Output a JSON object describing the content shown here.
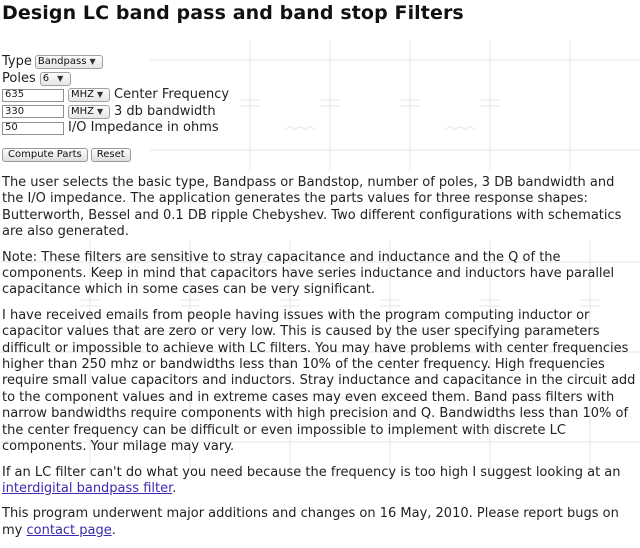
{
  "page": {
    "title": "Design LC band pass and band stop Filters"
  },
  "form": {
    "type_label": "Type",
    "type_value": "Bandpass",
    "poles_label": "Poles",
    "poles_value": "6",
    "center_freq_value": "635",
    "center_freq_unit": "MHZ",
    "center_freq_label": "Center Frequency",
    "bandwidth_value": "330",
    "bandwidth_unit": "MHZ",
    "bandwidth_label": "3 db bandwidth",
    "impedance_value": "50",
    "impedance_label": "I/O Impedance in ohms",
    "compute_label": "Compute Parts",
    "reset_label": "Reset"
  },
  "body": {
    "p1": "The user selects the basic type, Bandpass or Bandstop, number of poles, 3 DB bandwidth and the I/O impedance. The application generates the parts values for three response shapes: Butterworth, Bessel and 0.1 DB ripple Chebyshev. Two different configurations with schematics are also generated.",
    "p2": "Note: These filters are sensitive to stray capacitance and inductance and the Q of the components. Keep in mind that capacitors have series inductance and inductors have parallel capacitance which in some cases can be very significant.",
    "p3": "I have received emails from people having issues with the program computing inductor or capacitor values that are zero or very low. This is caused by the user specifying parameters difficult or impossible to achieve with LC filters. You may have problems with center frequencies higher than 250 mhz or bandwidths less than 10% of the center frequency. High frequencies require small value capacitors and inductors. Stray inductance and capacitance in the circuit add to the component values and in extreme cases may even exceed them. Band pass filters with narrow bandwidths require components with high precision and Q. Bandwidths less than 10% of the center frequency can be difficult or even impossible to implement with discrete LC components. Your milage may vary.",
    "p4_text": "If an LC filter can't do what you need because the frequency is too high I suggest looking at an",
    "p4_link": "interdigital bandpass filter",
    "p4_end": ".",
    "p5_text": "This program underwent major additions and changes on 16 May, 2010. Please report bugs on my",
    "p5_link": "contact page",
    "p5_end": "."
  }
}
